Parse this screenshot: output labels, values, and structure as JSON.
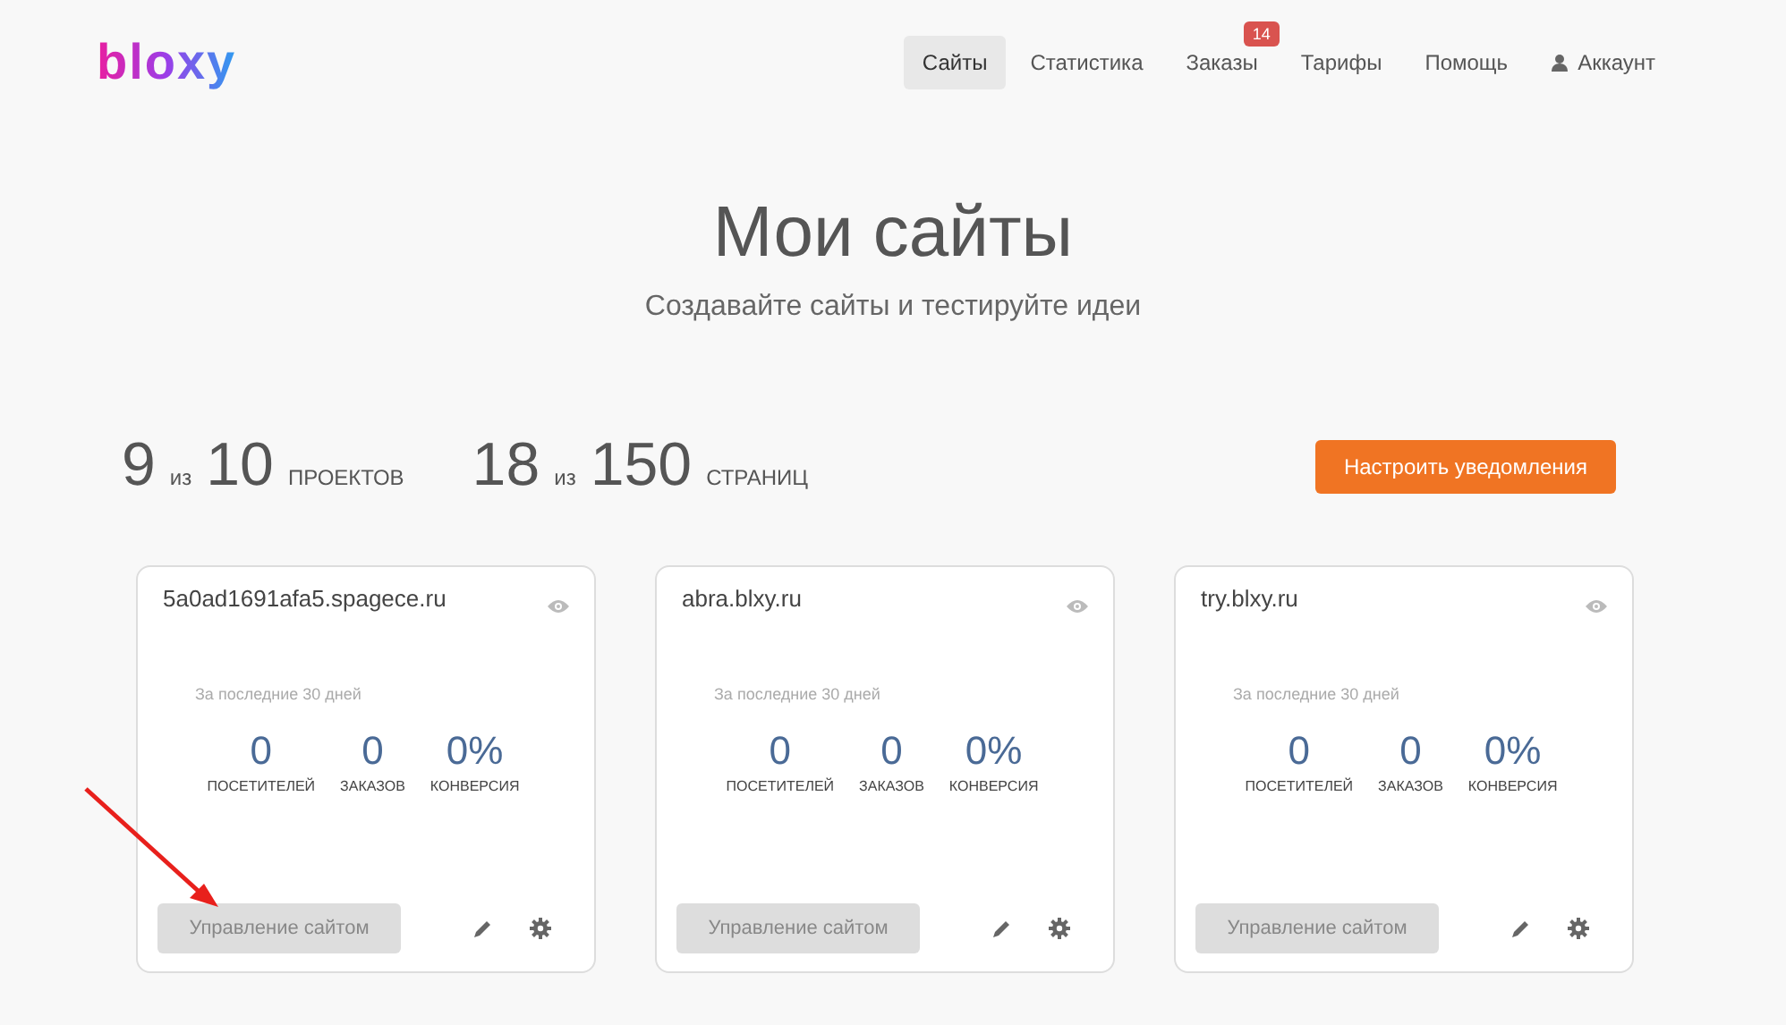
{
  "logo": "bloxy",
  "nav": [
    {
      "label": "Сайты",
      "selected": true
    },
    {
      "label": "Статистика",
      "selected": false
    },
    {
      "label": "Заказы",
      "selected": false,
      "badge": "14"
    },
    {
      "label": "Тарифы",
      "selected": false
    },
    {
      "label": "Помощь",
      "selected": false
    },
    {
      "label": "Аккаунт",
      "selected": false,
      "kind": "account"
    }
  ],
  "heading": {
    "title": "Мои сайты",
    "subtitle": "Создавайте сайты и тестируйте идеи"
  },
  "stats": [
    {
      "used": "9",
      "of": "из",
      "total": "10",
      "unit": "ПРОЕКТОВ"
    },
    {
      "used": "18",
      "of": "из",
      "total": "150",
      "unit": "СТРАНИЦ"
    }
  ],
  "notify_button": "Настроить уведомления",
  "sites": [
    {
      "domain": "5a0ad1691afa5.spagece.ru",
      "period": "За последние 30 дней",
      "metrics": [
        {
          "value": "0",
          "label": "ПОСЕТИТЕЛЕЙ"
        },
        {
          "value": "0",
          "label": "ЗАКАЗОВ"
        },
        {
          "value": "0%",
          "label": "КОНВЕРСИЯ"
        }
      ],
      "manage": "Управление сайтом"
    },
    {
      "domain": "abra.blxy.ru",
      "period": "За последние 30 дней",
      "metrics": [
        {
          "value": "0",
          "label": "ПОСЕТИТЕЛЕЙ"
        },
        {
          "value": "0",
          "label": "ЗАКАЗОВ"
        },
        {
          "value": "0%",
          "label": "КОНВЕРСИЯ"
        }
      ],
      "manage": "Управление сайтом"
    },
    {
      "domain": "try.blxy.ru",
      "period": "За последние 30 дней",
      "metrics": [
        {
          "value": "0",
          "label": "ПОСЕТИТЕЛЕЙ"
        },
        {
          "value": "0",
          "label": "ЗАКАЗОВ"
        },
        {
          "value": "0%",
          "label": "КОНВЕРСИЯ"
        }
      ],
      "manage": "Управление сайтом"
    }
  ]
}
